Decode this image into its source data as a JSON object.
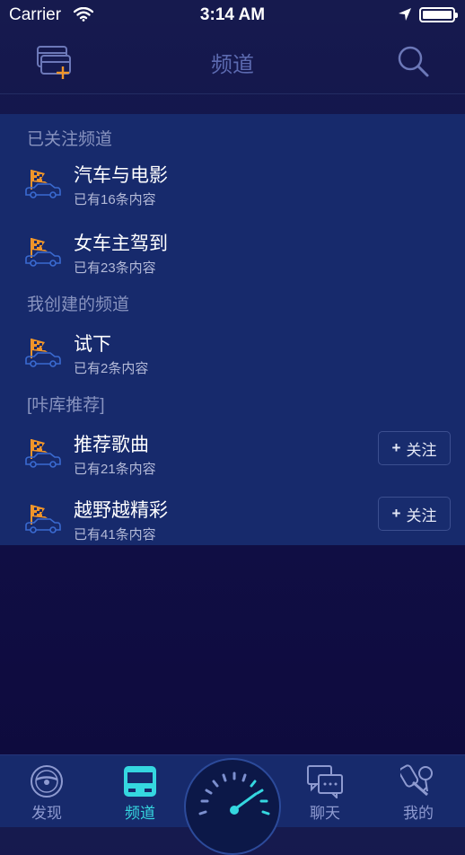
{
  "status_bar": {
    "carrier": "Carrier",
    "time": "3:14 AM"
  },
  "nav": {
    "title": "频道",
    "add_icon": "add-channel-icon",
    "search_icon": "search-icon"
  },
  "sections": [
    {
      "header": "已关注频道"
    },
    {
      "header": "我创建的频道"
    },
    {
      "header": "[咔库推荐]"
    }
  ],
  "channels": [
    {
      "title": "汽车与电影",
      "subtitle": "已有16条内容"
    },
    {
      "title": "女车主驾到",
      "subtitle": "已有23条内容"
    },
    {
      "title": "试下",
      "subtitle": "已有2条内容"
    },
    {
      "title": "推荐歌曲",
      "subtitle": "已有21条内容",
      "follow_label": "关注",
      "follow_plus": "+"
    },
    {
      "title": "越野越精彩",
      "subtitle": "已有41条内容",
      "follow_label": "关注",
      "follow_plus": "+"
    }
  ],
  "tabs": [
    {
      "label": "发现",
      "icon": "steering-wheel-icon"
    },
    {
      "label": "频道",
      "icon": "bus-icon",
      "active": true
    },
    {
      "label": "",
      "icon": "speedometer-icon"
    },
    {
      "label": "聊天",
      "icon": "chat-bubbles-icon"
    },
    {
      "label": "我的",
      "icon": "car-keys-icon"
    }
  ],
  "colors": {
    "accent": "#35d7e0",
    "list_bg": "#172a6c",
    "flag_orange": "#f0952a"
  }
}
